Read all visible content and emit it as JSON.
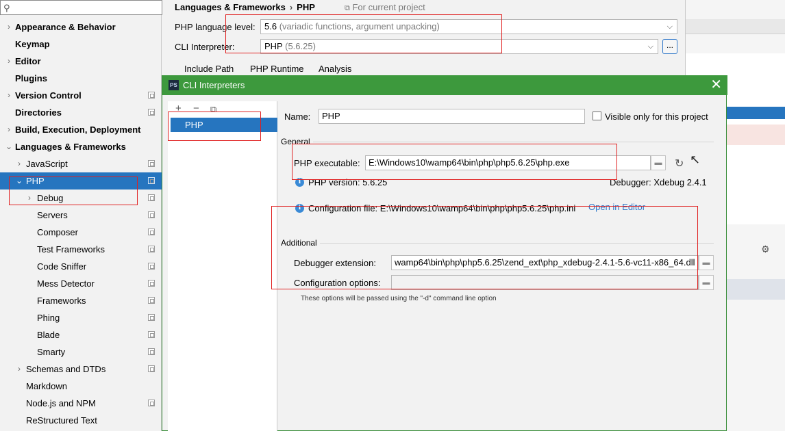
{
  "search": {
    "placeholder": ""
  },
  "tree": [
    {
      "label": "Appearance & Behavior",
      "bold": true,
      "arrow": "›",
      "level": 0,
      "proj": false,
      "selected": false
    },
    {
      "label": "Keymap",
      "bold": true,
      "arrow": "",
      "level": 0,
      "proj": false,
      "selected": false
    },
    {
      "label": "Editor",
      "bold": true,
      "arrow": "›",
      "level": 0,
      "proj": false,
      "selected": false
    },
    {
      "label": "Plugins",
      "bold": true,
      "arrow": "",
      "level": 0,
      "proj": false,
      "selected": false
    },
    {
      "label": "Version Control",
      "bold": true,
      "arrow": "›",
      "level": 0,
      "proj": true,
      "selected": false
    },
    {
      "label": "Directories",
      "bold": true,
      "arrow": "",
      "level": 0,
      "proj": true,
      "selected": false
    },
    {
      "label": "Build, Execution, Deployment",
      "bold": true,
      "arrow": "›",
      "level": 0,
      "proj": false,
      "selected": false
    },
    {
      "label": "Languages & Frameworks",
      "bold": true,
      "arrow": "⌄",
      "level": 0,
      "proj": false,
      "selected": false
    },
    {
      "label": "JavaScript",
      "bold": false,
      "arrow": "›",
      "level": 1,
      "proj": true,
      "selected": false
    },
    {
      "label": "PHP",
      "bold": false,
      "arrow": "⌄",
      "level": 1,
      "proj": true,
      "selected": true
    },
    {
      "label": "Debug",
      "bold": false,
      "arrow": "›",
      "level": 2,
      "proj": true,
      "selected": false
    },
    {
      "label": "Servers",
      "bold": false,
      "arrow": "",
      "level": 2,
      "proj": true,
      "selected": false
    },
    {
      "label": "Composer",
      "bold": false,
      "arrow": "",
      "level": 2,
      "proj": true,
      "selected": false
    },
    {
      "label": "Test Frameworks",
      "bold": false,
      "arrow": "",
      "level": 2,
      "proj": true,
      "selected": false
    },
    {
      "label": "Code Sniffer",
      "bold": false,
      "arrow": "",
      "level": 2,
      "proj": true,
      "selected": false
    },
    {
      "label": "Mess Detector",
      "bold": false,
      "arrow": "",
      "level": 2,
      "proj": true,
      "selected": false
    },
    {
      "label": "Frameworks",
      "bold": false,
      "arrow": "",
      "level": 2,
      "proj": true,
      "selected": false
    },
    {
      "label": "Phing",
      "bold": false,
      "arrow": "",
      "level": 2,
      "proj": true,
      "selected": false
    },
    {
      "label": "Blade",
      "bold": false,
      "arrow": "",
      "level": 2,
      "proj": true,
      "selected": false
    },
    {
      "label": "Smarty",
      "bold": false,
      "arrow": "",
      "level": 2,
      "proj": true,
      "selected": false
    },
    {
      "label": "Schemas and DTDs",
      "bold": false,
      "arrow": "›",
      "level": 1,
      "proj": true,
      "selected": false
    },
    {
      "label": "Markdown",
      "bold": false,
      "arrow": "",
      "level": 1,
      "proj": false,
      "selected": false
    },
    {
      "label": "Node.js and NPM",
      "bold": false,
      "arrow": "",
      "level": 1,
      "proj": true,
      "selected": false
    },
    {
      "label": "ReStructured Text",
      "bold": false,
      "arrow": "",
      "level": 1,
      "proj": false,
      "selected": false
    }
  ],
  "main": {
    "breadcrumb_parent": "Languages & Frameworks",
    "breadcrumb_sep": "›",
    "breadcrumb_current": "PHP",
    "for_project": "For current project",
    "language_level_label": "PHP language level:",
    "language_level_version": "5.6",
    "language_level_desc": "(variadic functions, argument unpacking)",
    "cli_label": "CLI Interpreter:",
    "cli_value": "PHP",
    "cli_version": "(5.6.25)",
    "browse_label": "...",
    "tabs": [
      "Include Path",
      "PHP Runtime",
      "Analysis"
    ]
  },
  "dialog": {
    "ps_logo": "PS",
    "title": "CLI Interpreters",
    "interpreter_item": "PHP",
    "name_label": "Name:",
    "name_value": "PHP",
    "visible_only_label": "Visible only for this project",
    "general_heading": "General",
    "executable_label": "PHP executable:",
    "executable_value": "E:\\Windows10\\wamp64\\bin\\php\\php5.6.25\\php.exe",
    "php_version": "PHP version: 5.6.25",
    "debugger": "Debugger: Xdebug 2.4.1",
    "config_file": "Configuration file: E:\\Windows10\\wamp64\\bin\\php\\php5.6.25\\php.ini",
    "open_in_editor": "Open in Editor",
    "additional_heading": "Additional",
    "debugger_ext_label": "Debugger extension:",
    "debugger_ext_value": "wamp64\\bin\\php\\php5.6.25\\zend_ext\\php_xdebug-2.4.1-5.6-vc11-x86_64.dll",
    "config_options_label": "Configuration options:",
    "config_options_value": "",
    "hint": "These options will be passed using the \"-d\" command line option"
  },
  "colors": {
    "selection": "#2675bf",
    "dialog_title": "#3d993d",
    "annotation": "#e02020",
    "link": "#2f77c9"
  }
}
